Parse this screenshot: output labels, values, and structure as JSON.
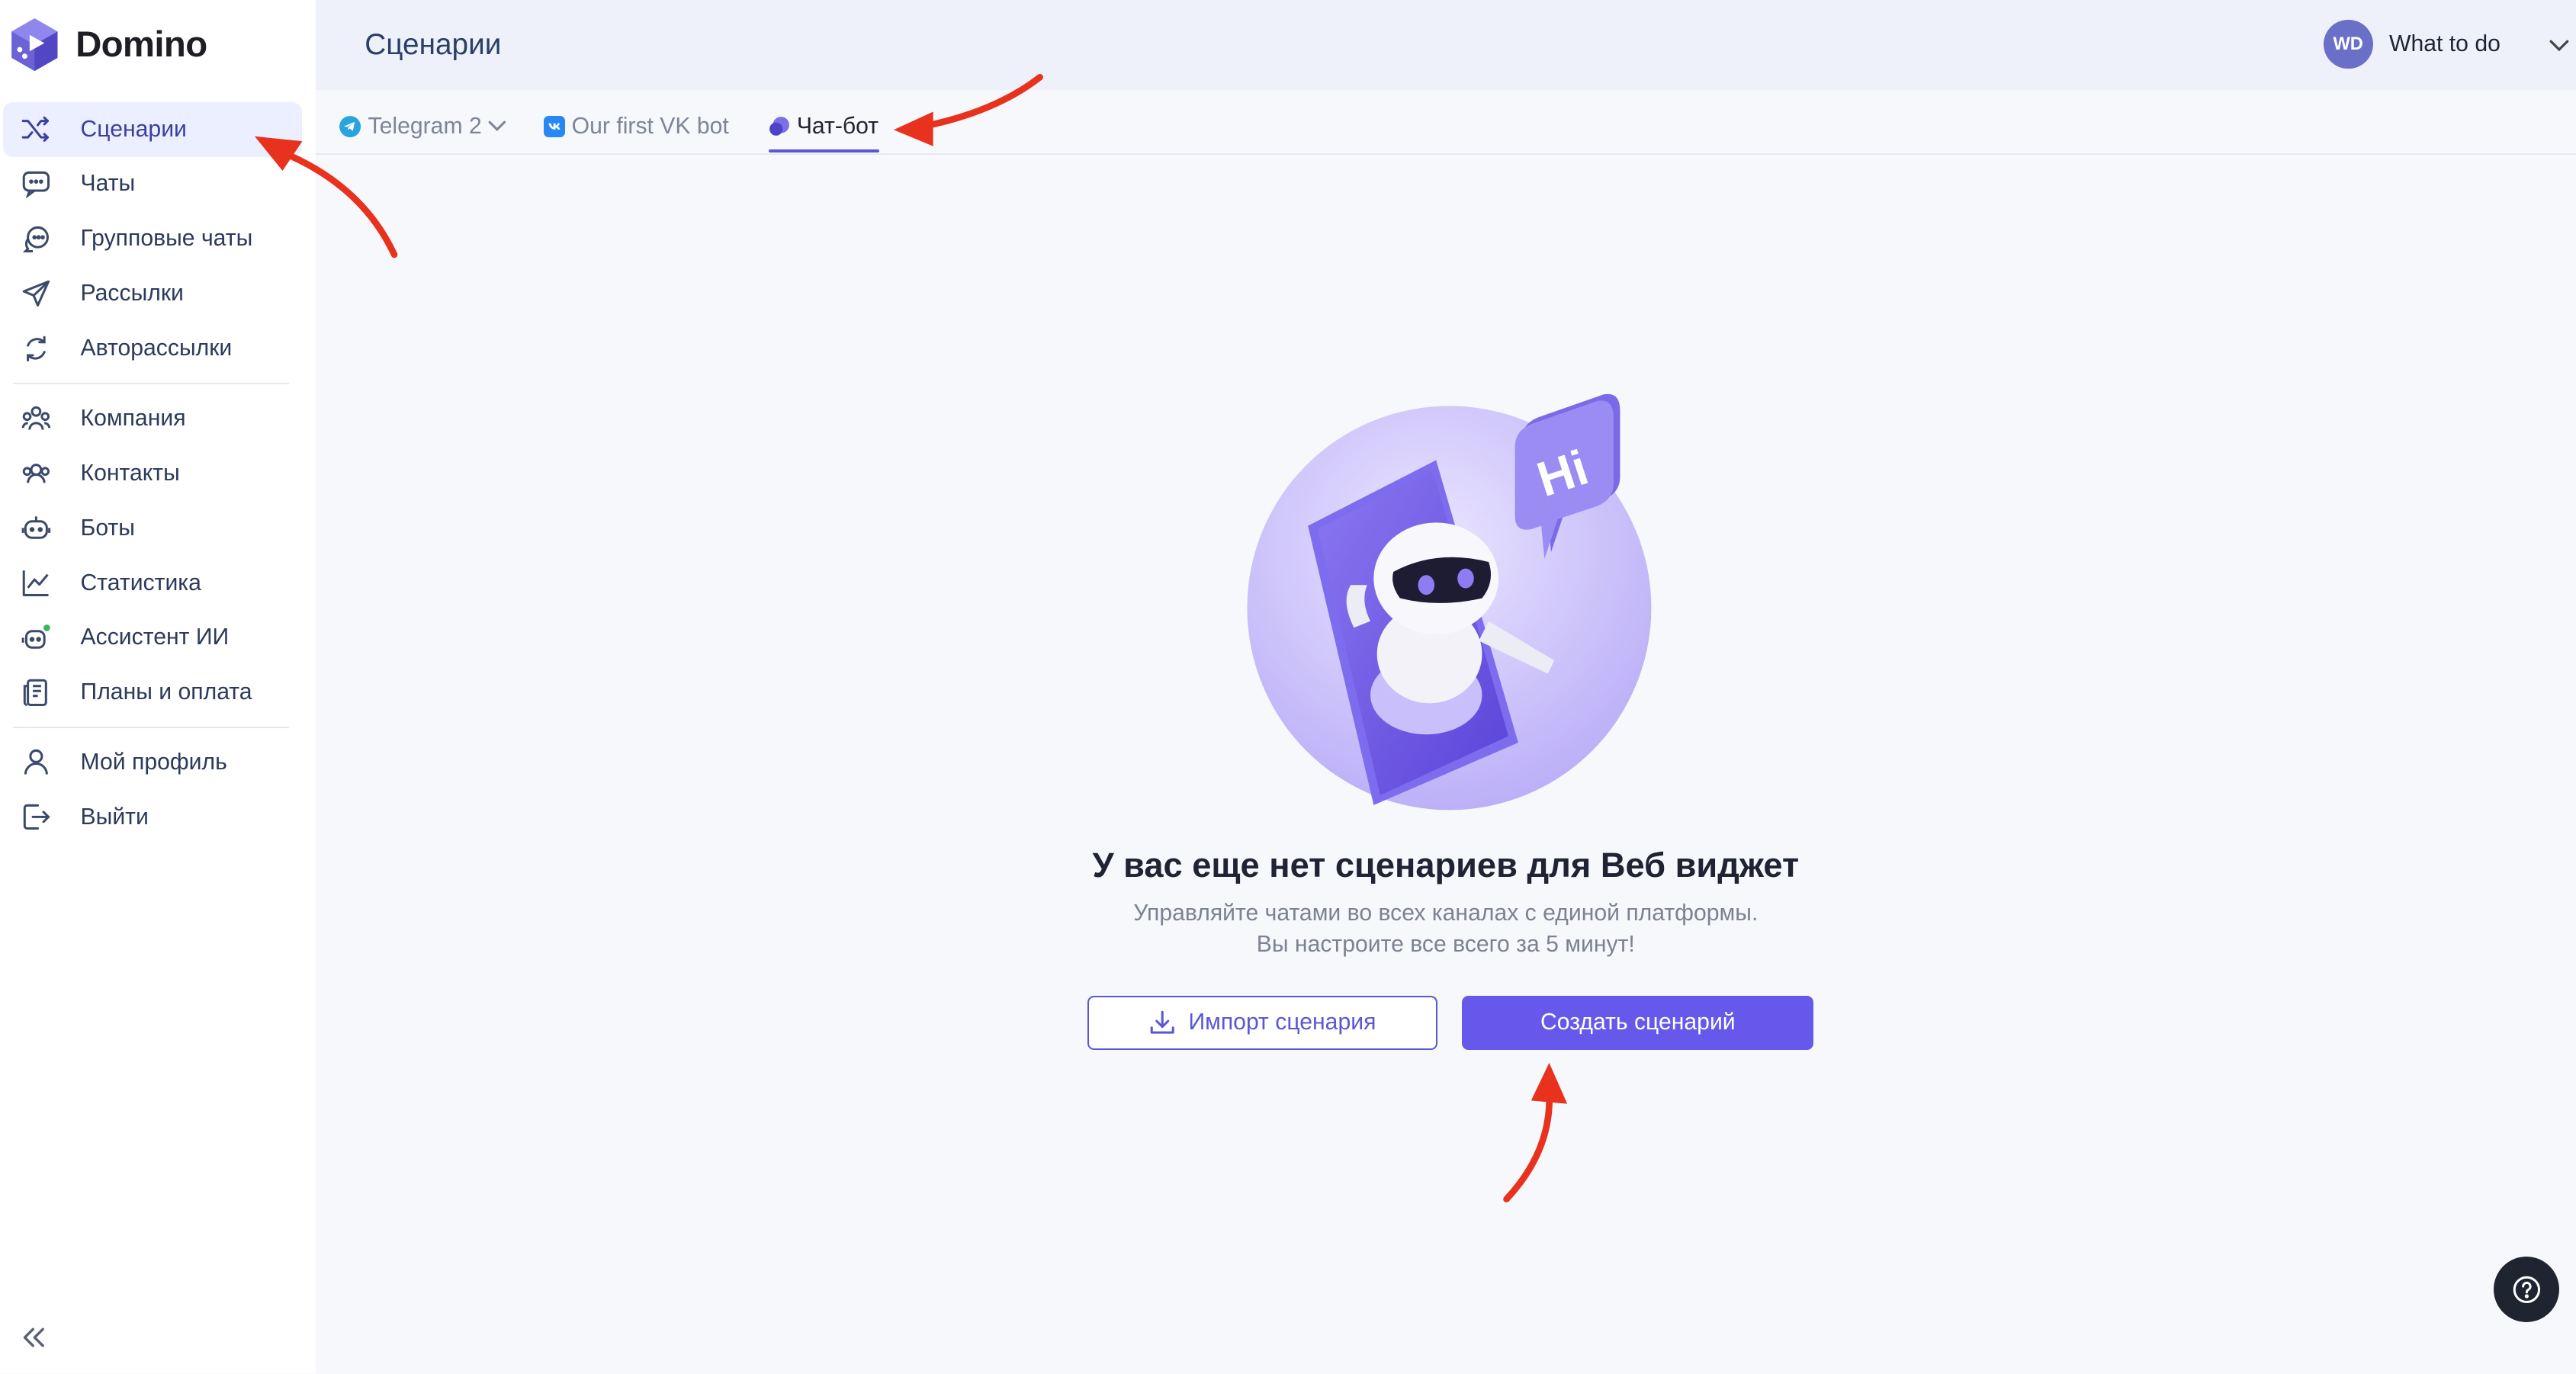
{
  "app": {
    "brand": "Domino"
  },
  "sidebar": {
    "items": [
      {
        "label": "Сценарии",
        "icon": "shuffle-icon",
        "active": true
      },
      {
        "label": "Чаты",
        "icon": "chat-bubble-icon"
      },
      {
        "label": "Групповые чаты",
        "icon": "group-chat-icon"
      },
      {
        "label": "Рассылки",
        "icon": "send-icon"
      },
      {
        "label": "Авторассылки",
        "icon": "auto-send-icon"
      },
      {
        "label": "Компания",
        "icon": "company-icon"
      },
      {
        "label": "Контакты",
        "icon": "contacts-icon"
      },
      {
        "label": "Боты",
        "icon": "bot-icon"
      },
      {
        "label": "Статистика",
        "icon": "chart-icon"
      },
      {
        "label": "Ассистент ИИ",
        "icon": "ai-assistant-icon"
      },
      {
        "label": "Планы и оплата",
        "icon": "billing-icon"
      },
      {
        "label": "Мой профиль",
        "icon": "profile-icon"
      },
      {
        "label": "Выйти",
        "icon": "logout-icon"
      }
    ],
    "collapse_icon": "double-chevron-left-icon"
  },
  "header": {
    "title": "Сценарии",
    "user": {
      "initials": "WD",
      "name": "What to do"
    }
  },
  "tabs": [
    {
      "label": "Telegram 2",
      "icon": "telegram-icon",
      "has_dropdown": true
    },
    {
      "label": "Our first VK bot",
      "icon": "vk-icon"
    },
    {
      "label": "Чат-бот",
      "icon": "web-chat-icon",
      "active": true
    }
  ],
  "empty_state": {
    "title": "У вас еще нет сценариев для Веб виджет",
    "subtitle_line1": "Управляйте чатами во всех каналах с единой платформы.",
    "subtitle_line2": "Вы настроите все всего за 5 минут!",
    "illustration_text": "Hi",
    "import_button": "Импорт сценария",
    "create_button": "Создать сценарий"
  },
  "colors": {
    "accent": "#6658ea",
    "sidebar_active_bg": "#ecefff",
    "header_bg": "#eef1fa",
    "annotation_arrow": "#e8321e"
  }
}
